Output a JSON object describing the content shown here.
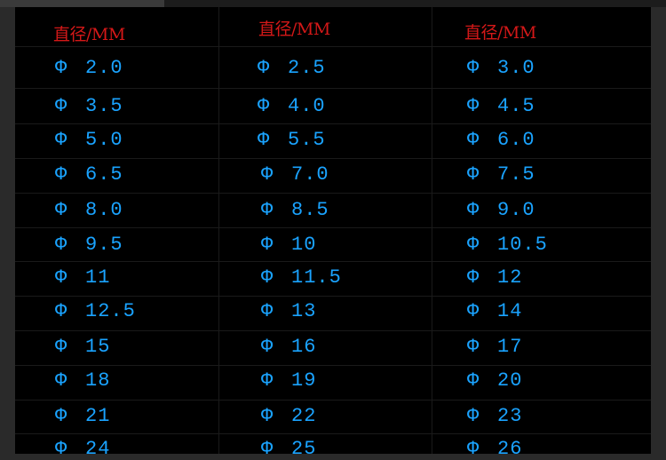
{
  "headers": [
    "直径/MM",
    "直径/MM",
    "直径/MM"
  ],
  "symbol": "Φ",
  "rows": [
    [
      "2.0",
      "2.5",
      "3.0"
    ],
    [
      "3.5",
      "4.0",
      "4.5"
    ],
    [
      "5.0",
      "5.5",
      "6.0"
    ],
    [
      "6.5",
      "7.0",
      "7.5"
    ],
    [
      "8.0",
      "8.5",
      "9.0"
    ],
    [
      "9.5",
      "10",
      "10.5"
    ],
    [
      "11",
      "11.5",
      "12"
    ],
    [
      "12.5",
      "13",
      "14"
    ],
    [
      "15",
      "16",
      "17"
    ],
    [
      "18",
      "19",
      "20"
    ],
    [
      "21",
      "22",
      "23"
    ],
    [
      "24",
      "25",
      "26"
    ]
  ],
  "colors": {
    "header": "#d41818",
    "value": "#1aa3ff",
    "background": "#000000"
  }
}
